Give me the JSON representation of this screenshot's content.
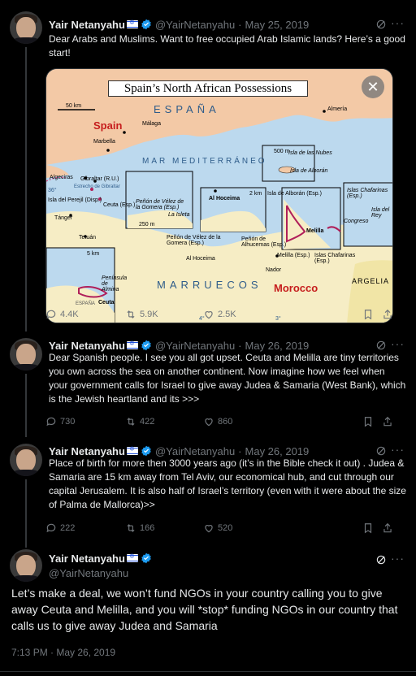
{
  "tweets": [
    {
      "name": "Yair Netanyahu",
      "handle": "@YairNetanyahu",
      "date": "May 25, 2019",
      "text": "Dear Arabs and Muslims. Want to free occupied Arab Islamic lands? Here’s a good start!",
      "replies": "4.4K",
      "retweets": "5.9K",
      "likes": "2.5K"
    },
    {
      "name": "Yair Netanyahu",
      "handle": "@YairNetanyahu",
      "date": "May 26, 2019",
      "text": "Dear Spanish people. I see you all got upset. Ceuta and Melilla are tiny territories you own across the sea on another continent. Now imagine how we feel when your government calls for Israel to give away Judea & Samaria (West Bank), which is the Jewish heartland and its >>>",
      "replies": "730",
      "retweets": "422",
      "likes": "860"
    },
    {
      "name": "Yair Netanyahu",
      "handle": "@YairNetanyahu",
      "date": "May 26, 2019",
      "text": "Place of birth for more then 3000 years ago (it’s in the Bible check it out) . Judea & Samaria are 15 km away from Tel Aviv, our economical hub, and cut through our capital Jerusalem. It is also half of Israel’s territory (even with it were about the size of Palma de Mallorca)>>",
      "replies": "222",
      "retweets": "166",
      "likes": "520"
    }
  ],
  "main_tweet": {
    "name": "Yair Netanyahu",
    "handle": "@YairNetanyahu",
    "text": "Let’s make a deal, we won’t fund NGOs in your country calling you to give away Ceuta and Melilla, and you will *stop* funding NGOs in our country that calls us to give away Judea and Samaria",
    "timestamp": "7:13 PM · May 26, 2019"
  },
  "map": {
    "title": "Spain’s North African Possessions",
    "espana": "ESPAÑA",
    "spain": "Spain",
    "marruecos": "MARRUECOS",
    "morocco": "Morocco",
    "argelia": "ARGELIA",
    "sea": "MAR MEDITERRÁNEO",
    "malaga": "Málaga",
    "marbella": "Marbella",
    "algeciras": "Algeciras",
    "gibraltar": "Gibraltar (R.U.)",
    "estrecho": "Estrecho de Gibraltar",
    "almeria": "Almería",
    "nubes": "Isla de las Nubes",
    "alboran": "Isla de Alborán",
    "alboran_esp": "Isla de Alborán (Esp.)",
    "perejil": "Isla del Perejil (Disp.)",
    "ceuta_esp": "Ceuta (Esp.)",
    "tanger": "Tánger",
    "tetuan": "Tetuán",
    "velez": "Peñón de Vélez de la Gomera (Esp.)",
    "isleta": "La Isleta",
    "alhoceima": "Al Hoceima",
    "alhucemas": "Peñón de Alhucemas (Esp.)",
    "nador": "Nador",
    "melilla": "Melilla",
    "melilla_esp": "Melilla (Esp.)",
    "chafarinas": "Islas Chafarinas (Esp.)",
    "congreso": "Congreso",
    "rey": "Isla del Rey",
    "ceuta": "Ceuta",
    "almina": "Península de Almina",
    "scale_50": "50 km",
    "scale_500": "500 m",
    "scale_250": "250 m",
    "scale_2": "2 km",
    "scale_5": "5 km",
    "lon_4": "4°",
    "lon_3": "3°",
    "lat_36": "36°"
  }
}
